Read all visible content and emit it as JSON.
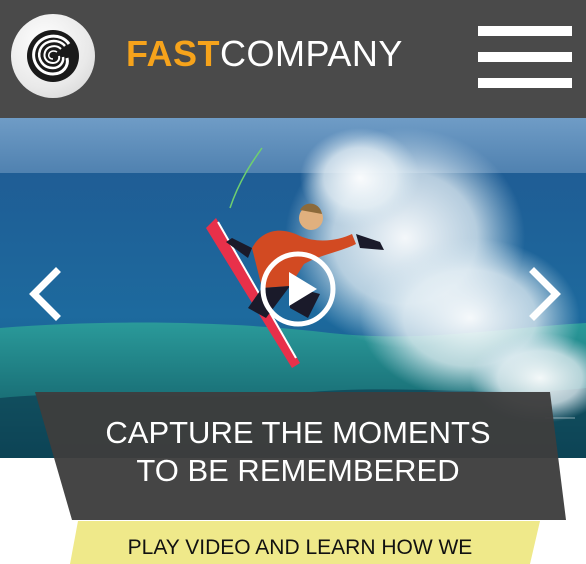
{
  "colors": {
    "header_bg": "#4a4a4a",
    "brand_accent": "#f6a31b",
    "caption_bg": "#3d3d3d",
    "cta_bg": "#efe98a"
  },
  "header": {
    "logo_icon": "spiral-wave-logo",
    "brand_fast": "FAST",
    "brand_company": "COMPANY",
    "menu_icon": "hamburger-menu-icon"
  },
  "hero": {
    "image": "surfer-riding-wave-photo",
    "prev_icon": "chevron-left-icon",
    "next_icon": "chevron-right-icon",
    "play_icon": "play-circle-icon"
  },
  "caption": {
    "line1": "CAPTURE THE MOMENTS",
    "line2": "TO BE REMEMBERED"
  },
  "cta": {
    "label": "PLAY VIDEO AND LEARN HOW WE"
  }
}
